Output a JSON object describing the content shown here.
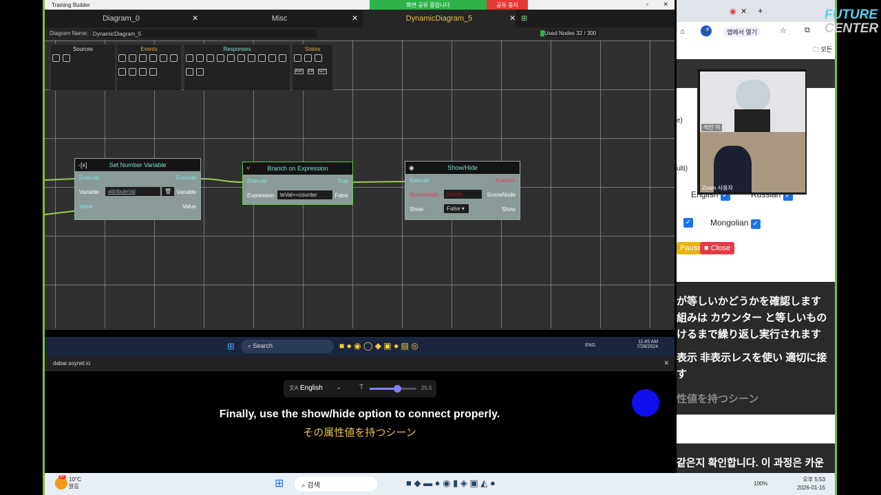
{
  "app": {
    "title": "Training Builder",
    "share_status": "화면 공유 중입니다",
    "stop_share": "공유 중지",
    "tabs": [
      {
        "label": "Diagram_0"
      },
      {
        "label": "Misc"
      },
      {
        "label": "DynamicDiagram_5",
        "active": true
      }
    ],
    "diagram_name_label": "Diagram Name:",
    "diagram_name": "DynamicDiagram_5",
    "used_nodes": "Used Nodes 32 / 300",
    "palettes": [
      "Sources",
      "Events",
      "Responses",
      "States"
    ],
    "state_buttons": [
      "AND",
      "OR",
      "NOT"
    ]
  },
  "nodes": [
    {
      "title": "Set Number Variable",
      "icon": "-[x]",
      "rows": [
        [
          "Execute",
          "Execute"
        ],
        [
          "Variable",
          "Variable"
        ],
        [
          "Value",
          "Value"
        ]
      ],
      "variable_value": "attributeVal"
    },
    {
      "title": "Branch on Expression",
      "rows": [
        [
          "Execute",
          "True"
        ],
        [
          "Expression",
          "False"
        ]
      ],
      "expression": "teVal==counter"
    },
    {
      "title": "Show/Hide",
      "rows": [
        [
          "Execute",
          "Execute"
        ],
        [
          "SceneNode",
          "SceneNode"
        ],
        [
          "Show",
          "Show"
        ]
      ],
      "scene_value": "(none)",
      "show_value": "False"
    }
  ],
  "remote_taskbar": {
    "search": "Search",
    "lang": "ENG",
    "time": "11:45 AM",
    "date": "7/28/2024"
  },
  "url": "dabar.soynet.io",
  "captions": {
    "language": "English",
    "font_size": "25.5",
    "font_slider_fraction": 0.6,
    "line1": "Finally, use the show/hide option to connect properly.",
    "line2": "その属性値を持つシーン"
  },
  "browser": {
    "open_in_app": "앱에서 열기",
    "bookmarks": "모든",
    "labels": [
      "e)",
      "ulti)"
    ],
    "langs": [
      "English",
      "Russian",
      "Mongolian"
    ],
    "pause": "Pause",
    "close": "Close"
  },
  "zoom": {
    "participant1": "석인 이",
    "participant2": "Zoom 사용자"
  },
  "subtitles": [
    "が等しいかどうかを確認します",
    "組みは カウンター と等しいもの",
    "けるまで繰り返し実行されます",
    "表示 非表示レスを使い 適切に接",
    "す",
    "性値を持つシーン"
  ],
  "subtitle_ko": "같은지 확인합니다. 이 과정은 카운",
  "logo": {
    "line1": "FUTURE",
    "line2": "CENTER"
  },
  "local_taskbar": {
    "weather_temp": "10°C",
    "weather_desc": "맑음",
    "badge": "9+",
    "search": "검색",
    "battery": "100%",
    "time": "오후 5:53",
    "date": "2026-01-15"
  }
}
